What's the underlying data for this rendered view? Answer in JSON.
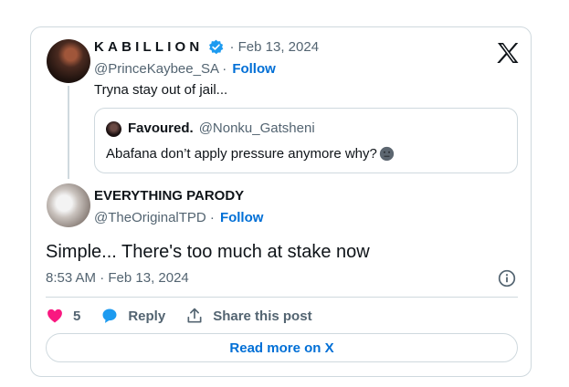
{
  "original_post": {
    "display_name": "KABILLION",
    "date": "· Feb 13, 2024",
    "handle": "@PrinceKaybee_SA ·",
    "follow_label": "Follow",
    "text": "Tryna stay out of jail..."
  },
  "quoted_post": {
    "display_name": "Favoured.",
    "handle": "@Nonku_Gatsheni",
    "text": "Abafana don’t apply pressure anymore why?"
  },
  "reply_post": {
    "display_name": "EVERYTHING PARODY",
    "handle": "@TheOriginalTPD ·",
    "follow_label": "Follow",
    "text": "Simple... There's too much at stake now",
    "timestamp": "8:53 AM · Feb 13, 2024"
  },
  "actions": {
    "like_count": "5",
    "reply_label": "Reply",
    "share_label": "Share this post"
  },
  "read_more_label": "Read more on X",
  "colors": {
    "accent": "#006fd6",
    "verified": "#1d9bf0",
    "like": "#f91880",
    "border": "#cfd9de",
    "muted": "#536471"
  },
  "icons": [
    "x-logo-icon",
    "verified-badge-icon",
    "info-icon",
    "heart-icon",
    "reply-bubble-icon",
    "share-icon",
    "emoji-icon"
  ]
}
